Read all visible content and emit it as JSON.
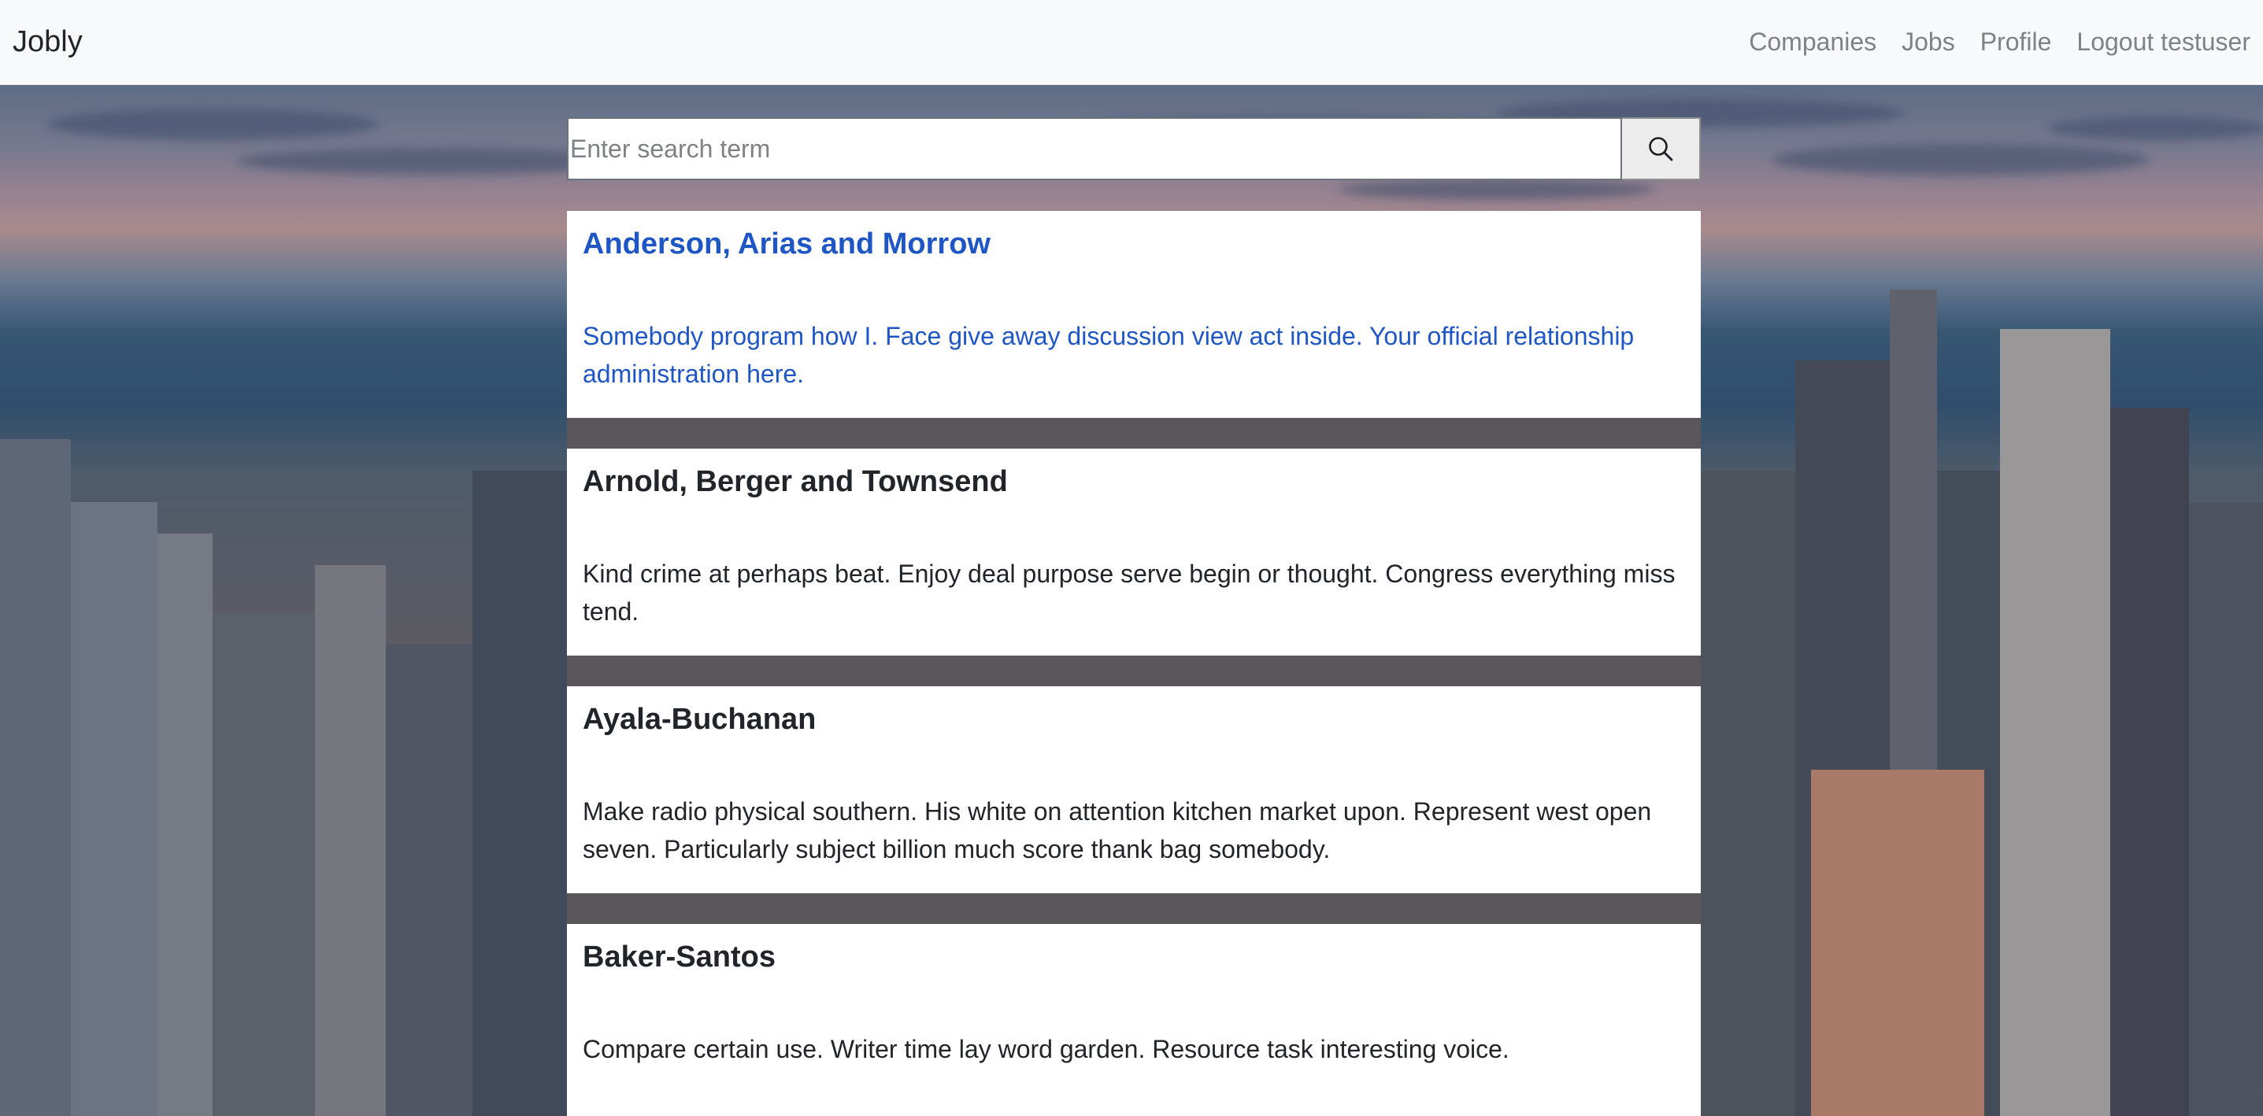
{
  "navbar": {
    "brand": "Jobly",
    "links": [
      "Companies",
      "Jobs",
      "Profile",
      "Logout testuser"
    ]
  },
  "search": {
    "placeholder": "Enter search term",
    "value": "",
    "button_icon": "search-icon"
  },
  "companies": [
    {
      "name": "Anderson, Arias and Morrow",
      "description": "Somebody program how I. Face give away discussion view act inside. Your official relationship administration here."
    },
    {
      "name": "Arnold, Berger and Townsend",
      "description": "Kind crime at perhaps beat. Enjoy deal purpose serve begin or thought. Congress everything miss tend."
    },
    {
      "name": "Ayala-Buchanan",
      "description": "Make radio physical southern. His white on attention kitchen market upon. Represent west open seven. Particularly subject billion much score thank bag somebody."
    },
    {
      "name": "Baker-Santos",
      "description": "Compare certain use. Writer time lay word garden. Resource task interesting voice."
    }
  ],
  "colors": {
    "link_active": "#1f56c5",
    "navbar_bg": "#f8f9fa",
    "nav_link": "#7d8287"
  }
}
